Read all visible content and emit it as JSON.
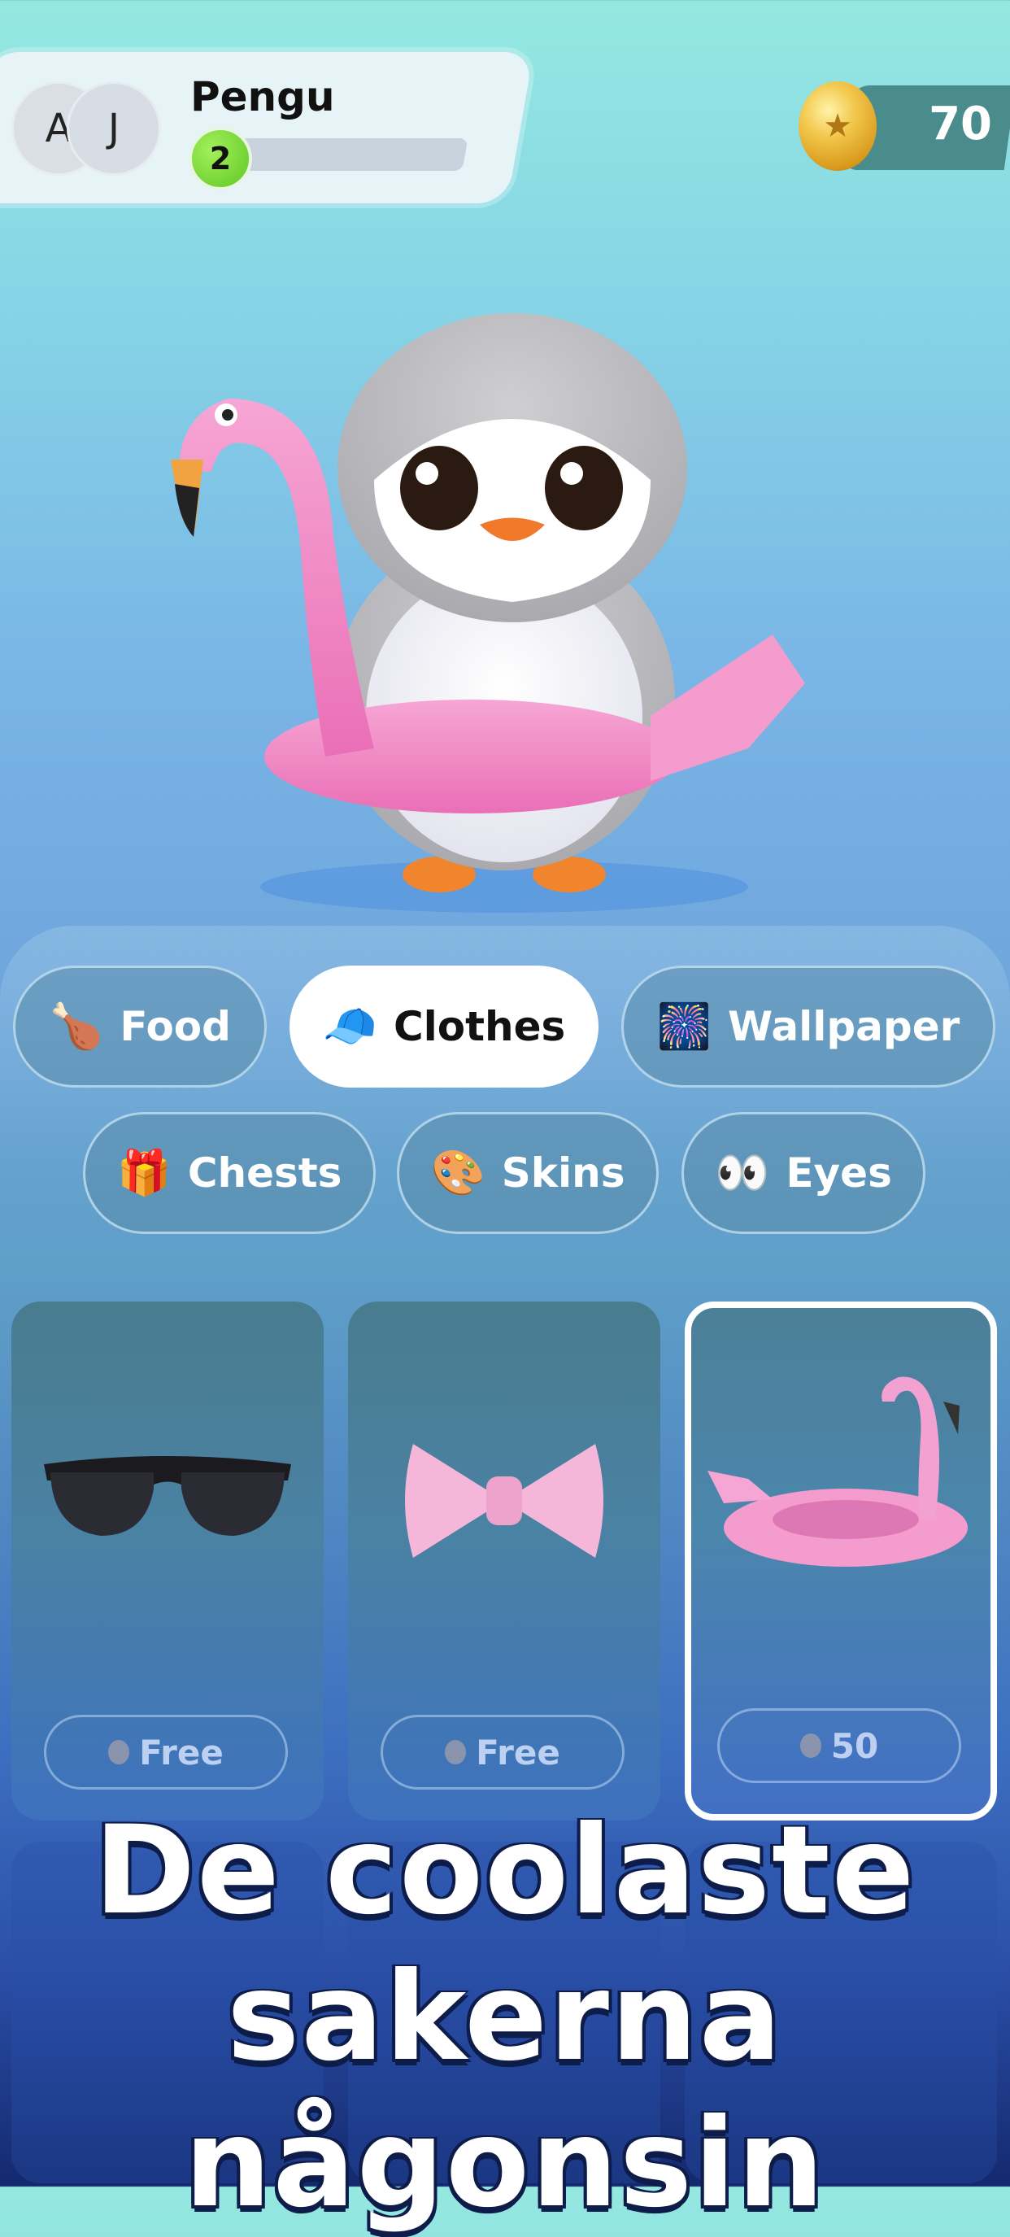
{
  "header": {
    "avatars": [
      "A",
      "J"
    ],
    "player_name": "Pengu",
    "level": "2",
    "coins": "70"
  },
  "tabs": [
    {
      "label": "Food",
      "icon": "drumstick-icon",
      "glyph": "🍗",
      "active": false
    },
    {
      "label": "Clothes",
      "icon": "cap-icon",
      "glyph": "🧢",
      "active": true
    },
    {
      "label": "Wallpaper",
      "icon": "fireworks-icon",
      "glyph": "🎆",
      "active": false
    },
    {
      "label": "Chests",
      "icon": "gift-icon",
      "glyph": "🎁",
      "active": false
    },
    {
      "label": "Skins",
      "icon": "palette-icon",
      "glyph": "🎨",
      "active": false
    },
    {
      "label": "Eyes",
      "icon": "eyes-icon",
      "glyph": "👀",
      "active": false
    }
  ],
  "items": [
    {
      "icon": "sunglasses-icon",
      "price": "Free",
      "selected": false
    },
    {
      "icon": "pink-bow-icon",
      "price": "Free",
      "selected": false
    },
    {
      "icon": "flamingo-float-icon",
      "price": "50",
      "selected": true
    }
  ],
  "promo": {
    "line1": "De coolaste",
    "line2": "sakerna",
    "line3": "någonsin"
  },
  "colors": {
    "accent_pink": "#f28ac4",
    "coin_gold": "#f2c74b",
    "level_green": "#5ec722",
    "active_tab_bg": "#ffffff"
  }
}
